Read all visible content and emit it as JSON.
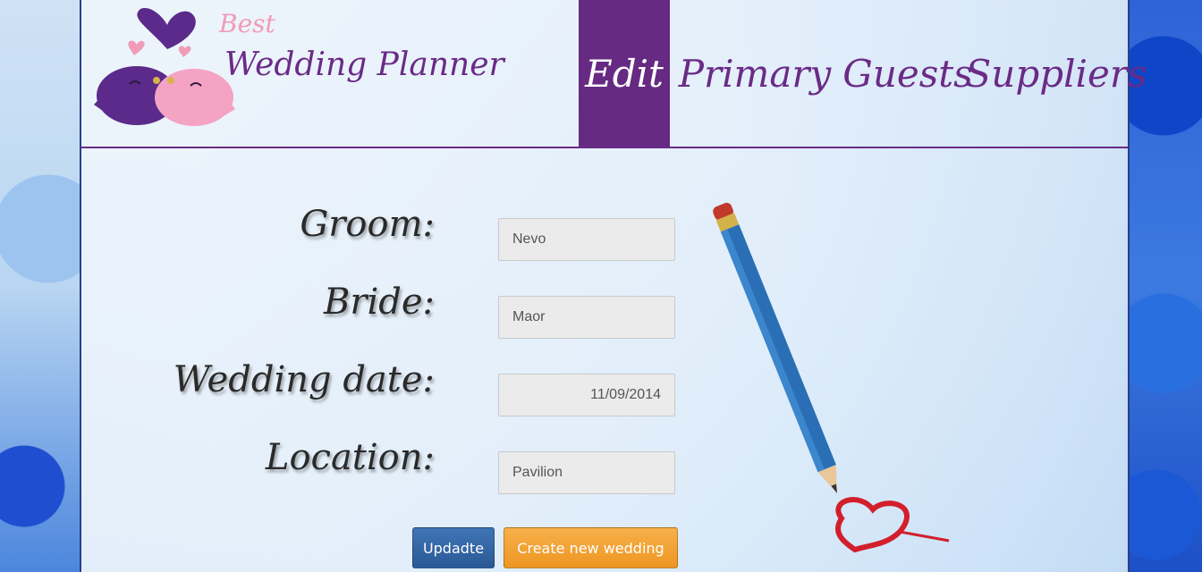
{
  "logo": {
    "best": "Best",
    "name": "Wedding Planner"
  },
  "nav": {
    "edit": "Edit",
    "primary": "Primary",
    "guests": "Guests",
    "suppliers": "Suppliers"
  },
  "form": {
    "groom": {
      "label": "Groom:",
      "value": "Nevo"
    },
    "bride": {
      "label": "Bride:",
      "value": "Maor"
    },
    "date": {
      "label": "Wedding date:",
      "value": "11/09/2014"
    },
    "location": {
      "label": "Location:",
      "value": "Pavilion"
    }
  },
  "buttons": {
    "update": "Updadte",
    "create": "Create new wedding"
  },
  "colors": {
    "brand_purple": "#662a82",
    "update_blue": "#2e5f9e",
    "create_orange": "#f0a032"
  }
}
